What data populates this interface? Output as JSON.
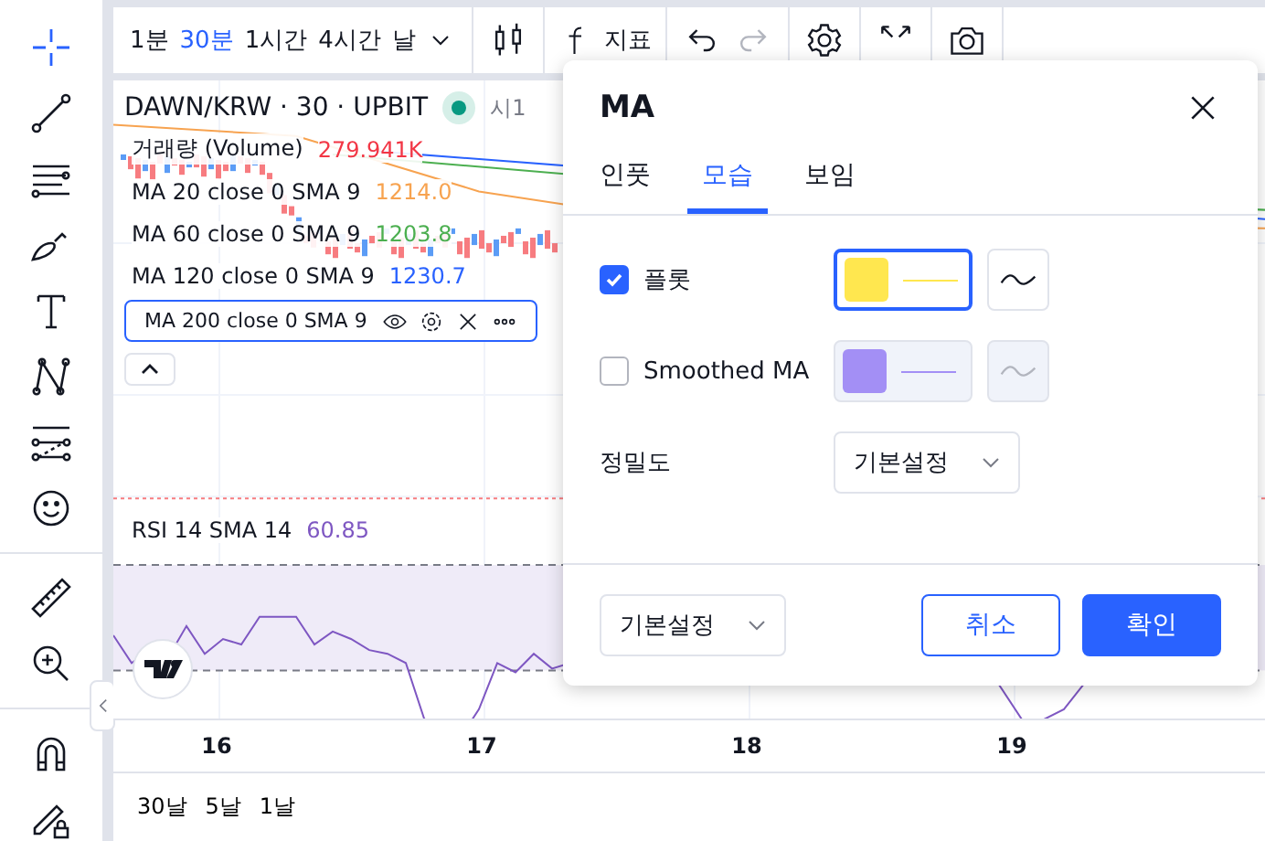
{
  "toolbar": {
    "timeframes": [
      {
        "label": "1분",
        "selected": false
      },
      {
        "label": "30분",
        "selected": true
      },
      {
        "label": "1시간",
        "selected": false
      },
      {
        "label": "4시간",
        "selected": false
      },
      {
        "label": "날",
        "selected": false
      }
    ],
    "indicators_label": "지표"
  },
  "chart": {
    "symbol": "DAWN/KRW · 30 · UPBIT",
    "open_label": "시1",
    "volume": {
      "label": "거래량 (Volume)",
      "value": "279.941K"
    },
    "studies": [
      {
        "label": "MA 20 close 0 SMA 9",
        "value": "1214.0",
        "color": "#f7a350",
        "selected": false
      },
      {
        "label": "MA 60 close 0 SMA 9",
        "value": "1203.8",
        "color": "#4caf50",
        "selected": false
      },
      {
        "label": "MA 120 close 0 SMA 9",
        "value": "1230.7",
        "color": "#2962ff",
        "selected": false
      },
      {
        "label": "MA 200 close 0 SMA 9",
        "selected": true
      }
    ],
    "rsi": {
      "label": "RSI 14 SMA 14",
      "value": "60.85"
    },
    "x_labels": [
      "16",
      "17",
      "18",
      "19"
    ]
  },
  "ranges": [
    "30날",
    "5날",
    "1날"
  ],
  "dialog": {
    "title": "MA",
    "tabs": [
      {
        "label": "인풋",
        "selected": false
      },
      {
        "label": "모습",
        "selected": true
      },
      {
        "label": "보임",
        "selected": false
      }
    ],
    "rows": [
      {
        "kind": "plot",
        "label": "플롯",
        "checked": true,
        "color": "#ffe74f"
      },
      {
        "kind": "plot",
        "label": "Smoothed MA",
        "checked": false,
        "color": "#a38ff5"
      },
      {
        "kind": "select",
        "label": "정밀도",
        "value": "기본설정"
      }
    ],
    "defaults": "기본설정",
    "cancel": "취소",
    "ok": "확인"
  }
}
